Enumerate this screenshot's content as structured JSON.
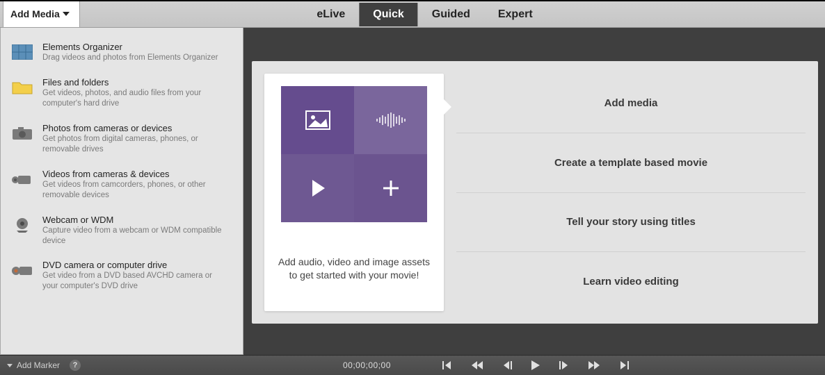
{
  "topbar": {
    "add_media_label": "Add Media",
    "tabs": [
      {
        "label": "eLive",
        "active": false
      },
      {
        "label": "Quick",
        "active": true
      },
      {
        "label": "Guided",
        "active": false
      },
      {
        "label": "Expert",
        "active": false
      }
    ]
  },
  "dropdown": [
    {
      "icon": "grid",
      "title": "Elements Organizer",
      "desc": "Drag videos and photos from Elements Organizer"
    },
    {
      "icon": "folder",
      "title": "Files and folders",
      "desc": "Get videos, photos, and audio files from your computer's hard drive"
    },
    {
      "icon": "camera",
      "title": "Photos from cameras or devices",
      "desc": "Get photos from digital cameras, phones, or removable drives"
    },
    {
      "icon": "camcorder",
      "title": "Videos from cameras & devices",
      "desc": "Get videos from camcorders, phones, or other removable devices"
    },
    {
      "icon": "webcam",
      "title": "Webcam or WDM",
      "desc": "Capture video from a webcam or WDM compatible device"
    },
    {
      "icon": "dvd",
      "title": "DVD camera or computer drive",
      "desc": "Get video from a DVD based AVCHD camera or your computer's DVD drive"
    }
  ],
  "quick_card": {
    "caption": "Add audio, video and image assets to get started with your movie!"
  },
  "quick_options": [
    "Add media",
    "Create a template based movie",
    "Tell your story using titles",
    "Learn video editing"
  ],
  "bottombar": {
    "add_marker_label": "Add Marker",
    "help_label": "?",
    "timecode": "00;00;00;00"
  }
}
